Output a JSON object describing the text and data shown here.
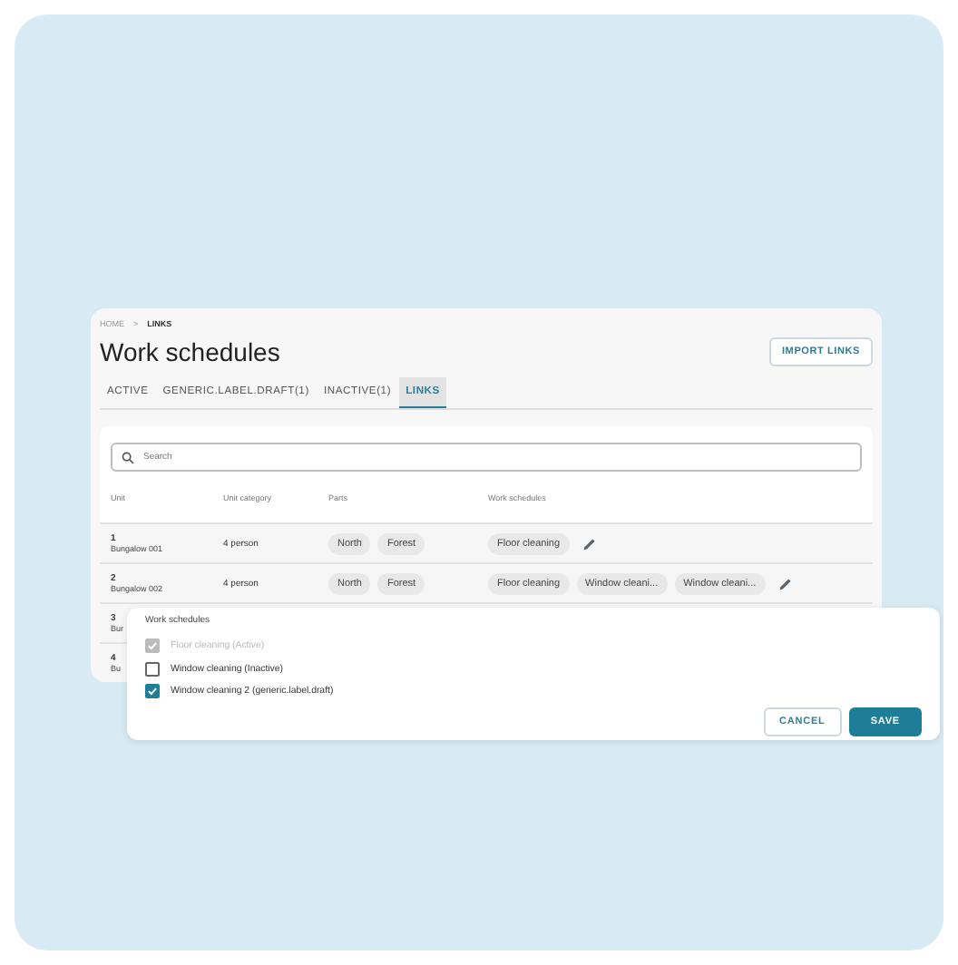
{
  "breadcrumb": [
    {
      "label": "HOME",
      "current": false
    },
    {
      "label": "LINKS",
      "current": true
    }
  ],
  "separator": ">",
  "title": "Work schedules",
  "import_button": "IMPORT LINKS",
  "tabs": [
    {
      "label": "ACTIVE",
      "selected": false
    },
    {
      "label": "GENERIC.LABEL.DRAFT(1)",
      "selected": false
    },
    {
      "label": "INACTIVE(1)",
      "selected": false
    },
    {
      "label": "LINKS",
      "selected": true
    }
  ],
  "search": {
    "placeholder": "Search"
  },
  "table": {
    "columns": [
      "Unit",
      "Unit category",
      "Parts",
      "Work schedules"
    ],
    "rows": [
      {
        "number": "1",
        "name": "Bungalow 001",
        "category": "4 person",
        "parts": [
          "North",
          "Forest"
        ],
        "schedules": [
          "Floor cleaning"
        ],
        "editable": true
      },
      {
        "number": "2",
        "name": "Bungalow 002",
        "category": "4 person",
        "parts": [
          "North",
          "Forest"
        ],
        "schedules": [
          "Floor cleaning",
          "Window cleani...",
          "Window cleani..."
        ],
        "editable": true
      },
      {
        "number": "3",
        "name": "Bur",
        "parts": [],
        "schedules": []
      },
      {
        "number": "4",
        "name": "Bu",
        "parts": [],
        "schedules": []
      }
    ]
  },
  "dialog": {
    "title": "Work schedules",
    "options": [
      {
        "label": "Floor cleaning (Active)",
        "checked": true,
        "disabled": true
      },
      {
        "label": "Window cleaning (Inactive)",
        "checked": false,
        "disabled": false
      },
      {
        "label": "Window cleaning 2 (generic.label.draft)",
        "checked": true,
        "disabled": false
      }
    ],
    "buttons": [
      {
        "label": "CANCEL",
        "kind": "secondary"
      },
      {
        "label": "SAVE",
        "kind": "primary"
      }
    ]
  }
}
